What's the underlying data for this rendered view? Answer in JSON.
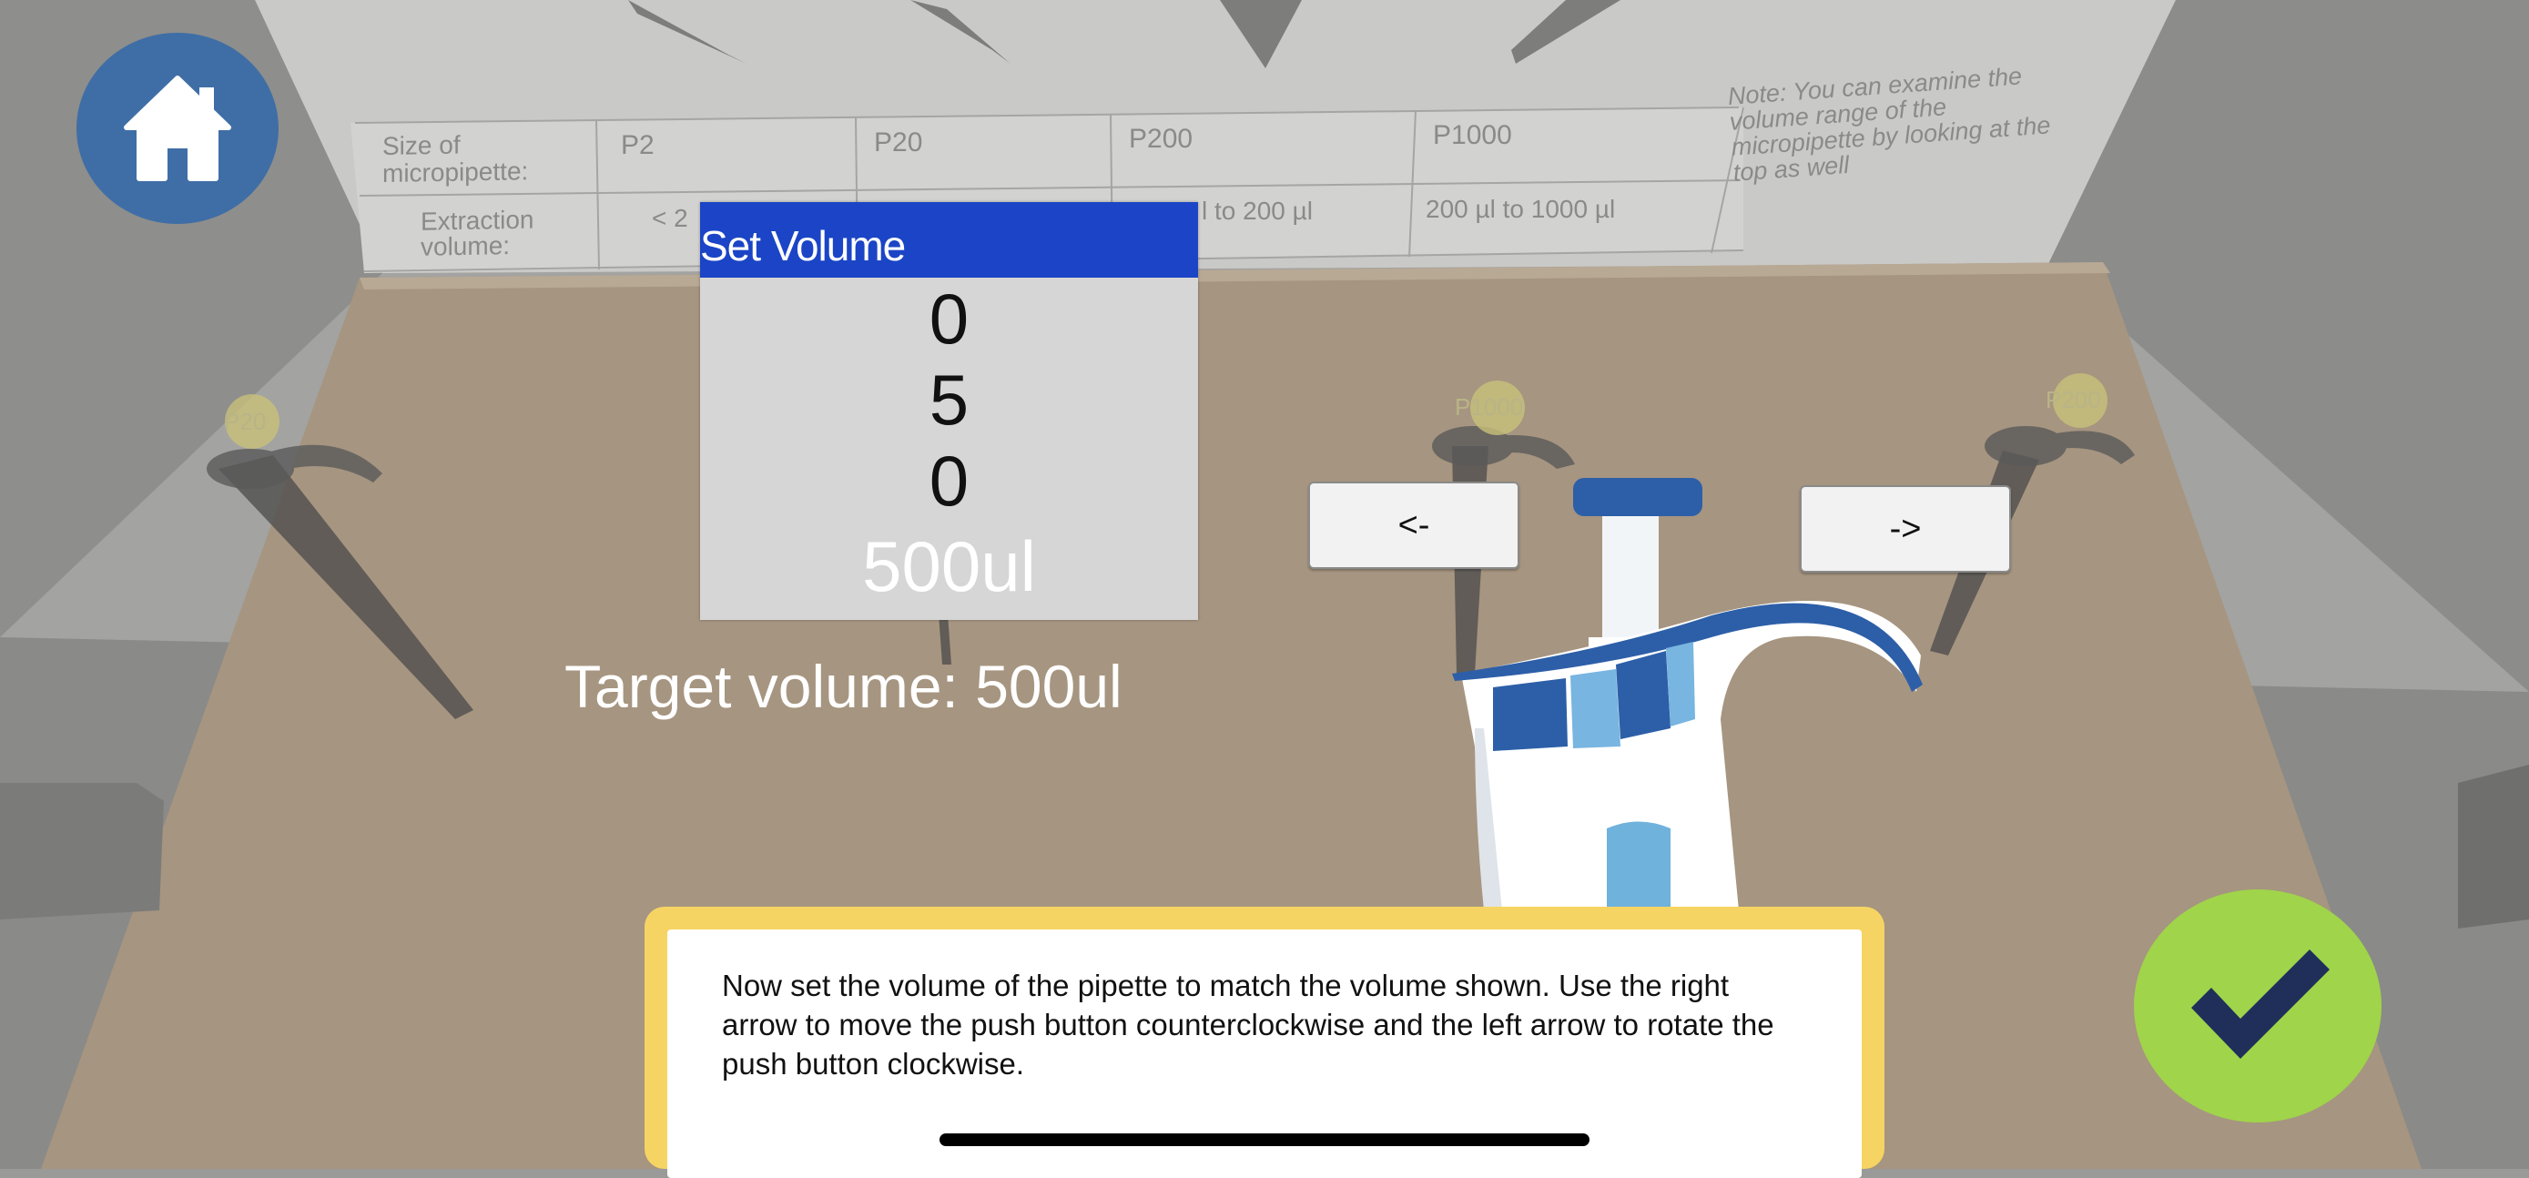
{
  "volume_table": {
    "row1_label": "Size of micropipette:",
    "row2_label": "Extraction volume:",
    "sizes": [
      "P2",
      "P20",
      "P200",
      "P1000"
    ],
    "ranges": [
      "< 2",
      "",
      "l to 200 µl",
      "200 µl to 1000 µl"
    ],
    "note": "Note: You can examine the volume range of the micropipette by looking at the top as well"
  },
  "pipette_labels": {
    "left": "P20",
    "middle": "P1000",
    "right": "P200"
  },
  "set_volume": {
    "title": "Set Volume",
    "digits": [
      "0",
      "5",
      "0"
    ],
    "total": "500ul"
  },
  "target_volume": "Target volume: 500ul",
  "arrows": {
    "left_label": "<-",
    "right_label": "->"
  },
  "instruction": "Now set the volume of the pipette to match the volume shown. Use the right arrow to move the push button counterclockwise and the left arrow to rotate the push button clockwise.",
  "icons": {
    "home": "home-icon",
    "confirm": "checkmark-icon"
  },
  "colors": {
    "title_bar": "#1b45c6",
    "home_button": "#3f6ea6",
    "confirm_button": "#a0d44b",
    "instruction_border": "#f6d463"
  }
}
